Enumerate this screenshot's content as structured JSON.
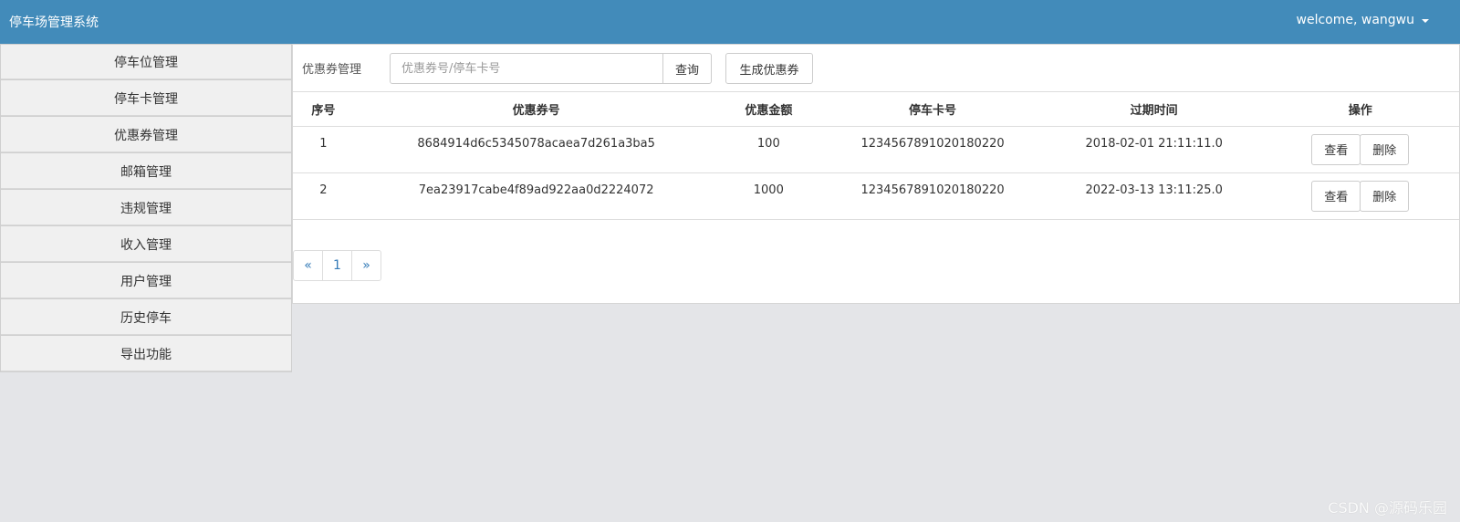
{
  "header": {
    "title": "停车场管理系统",
    "user_menu": "welcome, wangwu"
  },
  "sidebar": {
    "items": [
      {
        "label": "停车位管理"
      },
      {
        "label": "停车卡管理"
      },
      {
        "label": "优惠券管理"
      },
      {
        "label": "邮箱管理"
      },
      {
        "label": "违规管理"
      },
      {
        "label": "收入管理"
      },
      {
        "label": "用户管理"
      },
      {
        "label": "历史停车"
      },
      {
        "label": "导出功能"
      }
    ]
  },
  "toolbar": {
    "label": "优惠券管理",
    "search_placeholder": "优惠券号/停车卡号",
    "search_value": "",
    "query_label": "查询",
    "generate_label": "生成优惠券"
  },
  "table": {
    "columns": [
      "序号",
      "优惠券号",
      "优惠金额",
      "停车卡号",
      "过期时间",
      "操作"
    ],
    "rows": [
      {
        "index": "1",
        "coupon_no": "8684914d6c5345078acaea7d261a3ba5",
        "amount": "100",
        "card_no": "1234567891020180220",
        "expire": "2018-02-01 21:11:11.0",
        "view_label": "查看",
        "delete_label": "删除"
      },
      {
        "index": "2",
        "coupon_no": "7ea23917cabe4f89ad922aa0d2224072",
        "amount": "1000",
        "card_no": "1234567891020180220",
        "expire": "2022-03-13 13:11:25.0",
        "view_label": "查看",
        "delete_label": "删除"
      }
    ]
  },
  "pagination": {
    "prev": "«",
    "current": "1",
    "next": "»"
  },
  "watermark": "CSDN @源码乐园",
  "colors": {
    "header_bg": "#428bba",
    "page_bg": "#e4e5e8",
    "link": "#337ab7"
  }
}
